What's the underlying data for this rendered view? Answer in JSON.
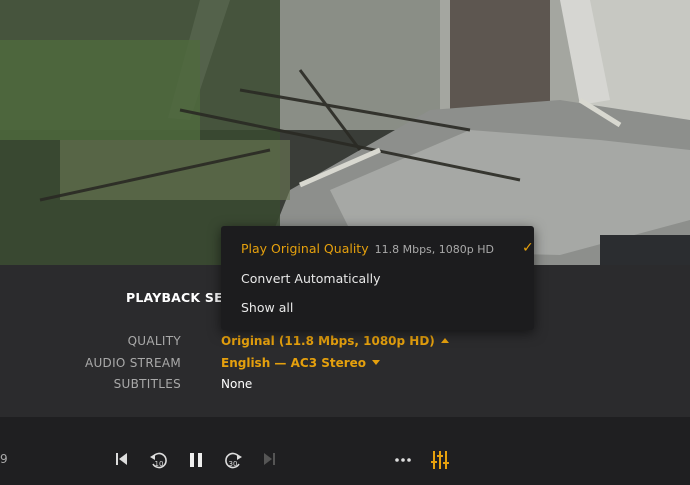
{
  "panel": {
    "title": "PLAYBACK SETTINGS",
    "rows": [
      {
        "label": "QUALITY",
        "value": "Original (11.8 Mbps, 1080p HD)"
      },
      {
        "label": "AUDIO STREAM",
        "value": "English — AC3 Stereo"
      },
      {
        "label": "SUBTITLES",
        "value": "None"
      }
    ]
  },
  "quality_menu": {
    "items": [
      {
        "label": "Play Original Quality",
        "detail": "11.8 Mbps, 1080p HD",
        "selected": true
      },
      {
        "label": "Convert Automatically"
      },
      {
        "label": "Show all"
      }
    ],
    "check_glyph": "✓"
  },
  "player": {
    "time": "9",
    "replay_seconds": "10",
    "forward_seconds": "30",
    "icons": [
      "skip-previous-icon",
      "replay-10-icon",
      "pause-icon",
      "forward-30-icon",
      "skip-next-icon",
      "more-icon",
      "audio-settings-icon"
    ]
  },
  "colors": {
    "accent": "#e5a00d",
    "panel": "#2a2a2c"
  }
}
